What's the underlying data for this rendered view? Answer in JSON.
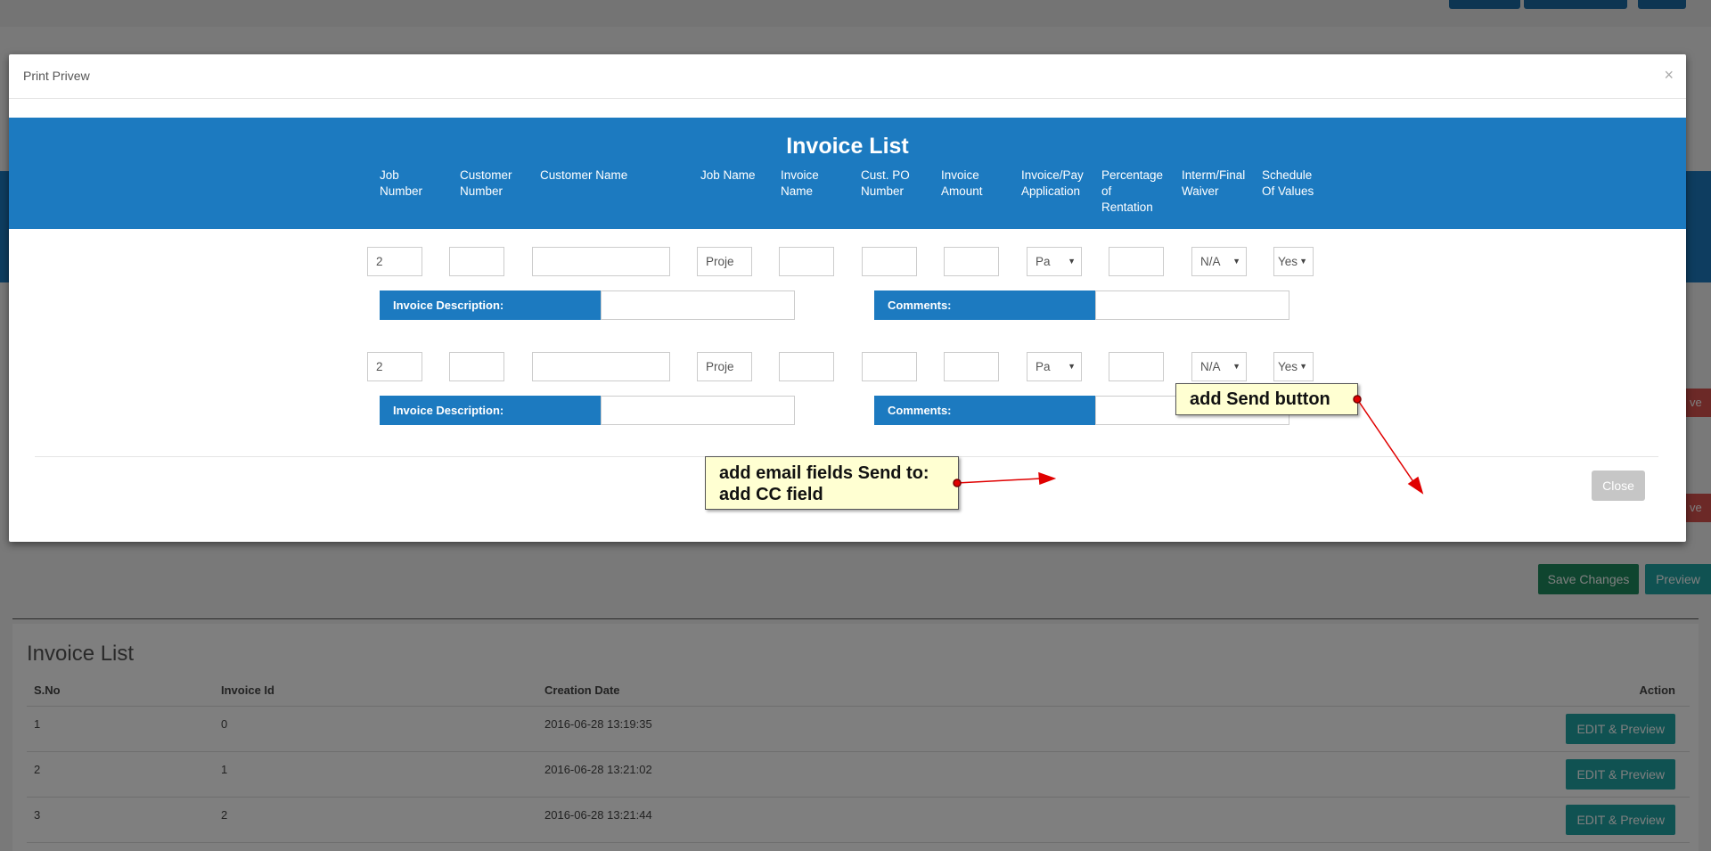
{
  "background": {
    "save_changes_label": "Save Changes",
    "preview_label": "Preview",
    "side_button_label": "ve",
    "invoice_list": {
      "title": "Invoice List",
      "columns": [
        "S.No",
        "Invoice Id",
        "Creation Date",
        "Action"
      ],
      "rows": [
        {
          "sno": "1",
          "invoice_id": "0",
          "created": "2016-06-28 13:19:35",
          "action": "EDIT & Preview"
        },
        {
          "sno": "2",
          "invoice_id": "1",
          "created": "2016-06-28 13:21:02",
          "action": "EDIT & Preview"
        },
        {
          "sno": "3",
          "invoice_id": "2",
          "created": "2016-06-28 13:21:44",
          "action": "EDIT & Preview"
        }
      ]
    }
  },
  "modal": {
    "title": "Print Privew",
    "close_x": "×",
    "invoice_title": "Invoice List",
    "columns": [
      {
        "l1": "Job",
        "l2": "Number",
        "l3": ""
      },
      {
        "l1": "Customer",
        "l2": "Number",
        "l3": ""
      },
      {
        "l1": "Customer Name",
        "l2": "",
        "l3": ""
      },
      {
        "l1": "Job Name",
        "l2": "",
        "l3": ""
      },
      {
        "l1": "Invoice",
        "l2": "Name",
        "l3": ""
      },
      {
        "l1": "Cust. PO",
        "l2": "Number",
        "l3": ""
      },
      {
        "l1": "Invoice",
        "l2": "Amount",
        "l3": ""
      },
      {
        "l1": "Invoice/Pay",
        "l2": "Application",
        "l3": ""
      },
      {
        "l1": "Percentage",
        "l2": "of",
        "l3": "Rentation"
      },
      {
        "l1": "Interm/Final",
        "l2": "Waiver",
        "l3": ""
      },
      {
        "l1": "Schedule",
        "l2": "Of Values",
        "l3": ""
      }
    ],
    "rows": [
      {
        "job_number": "2",
        "customer_number": "",
        "customer_name": "",
        "job_name": "Proje",
        "invoice_name": "",
        "cust_po": "",
        "invoice_amount": "",
        "pay_application": "Pa",
        "percentage": "",
        "waiver": "N/A",
        "schedule": "Yes",
        "invoice_description_label": "Invoice Description:",
        "invoice_description": "",
        "comments_label": "Comments:",
        "comments": ""
      },
      {
        "job_number": "2",
        "customer_number": "",
        "customer_name": "",
        "job_name": "Proje",
        "invoice_name": "",
        "cust_po": "",
        "invoice_amount": "",
        "pay_application": "Pa",
        "percentage": "",
        "waiver": "N/A",
        "schedule": "Yes",
        "invoice_description_label": "Invoice Description:",
        "invoice_description": "",
        "comments_label": "Comments:",
        "comments": ""
      }
    ],
    "close_label": "Close"
  },
  "annotations": {
    "send_button": "add Send button",
    "email_line1": "add email fields Send to:",
    "email_line2": "add CC field"
  },
  "colors": {
    "brand_blue": "#1c7ac0",
    "teal_button": "#20a5a5",
    "green_button": "#1e8a5e",
    "danger_red": "#d9534f",
    "callout_bg": "#ffffd2",
    "arrow_red": "#e00000"
  },
  "icons": [
    "close-icon",
    "dropdown-arrow-icon"
  ]
}
